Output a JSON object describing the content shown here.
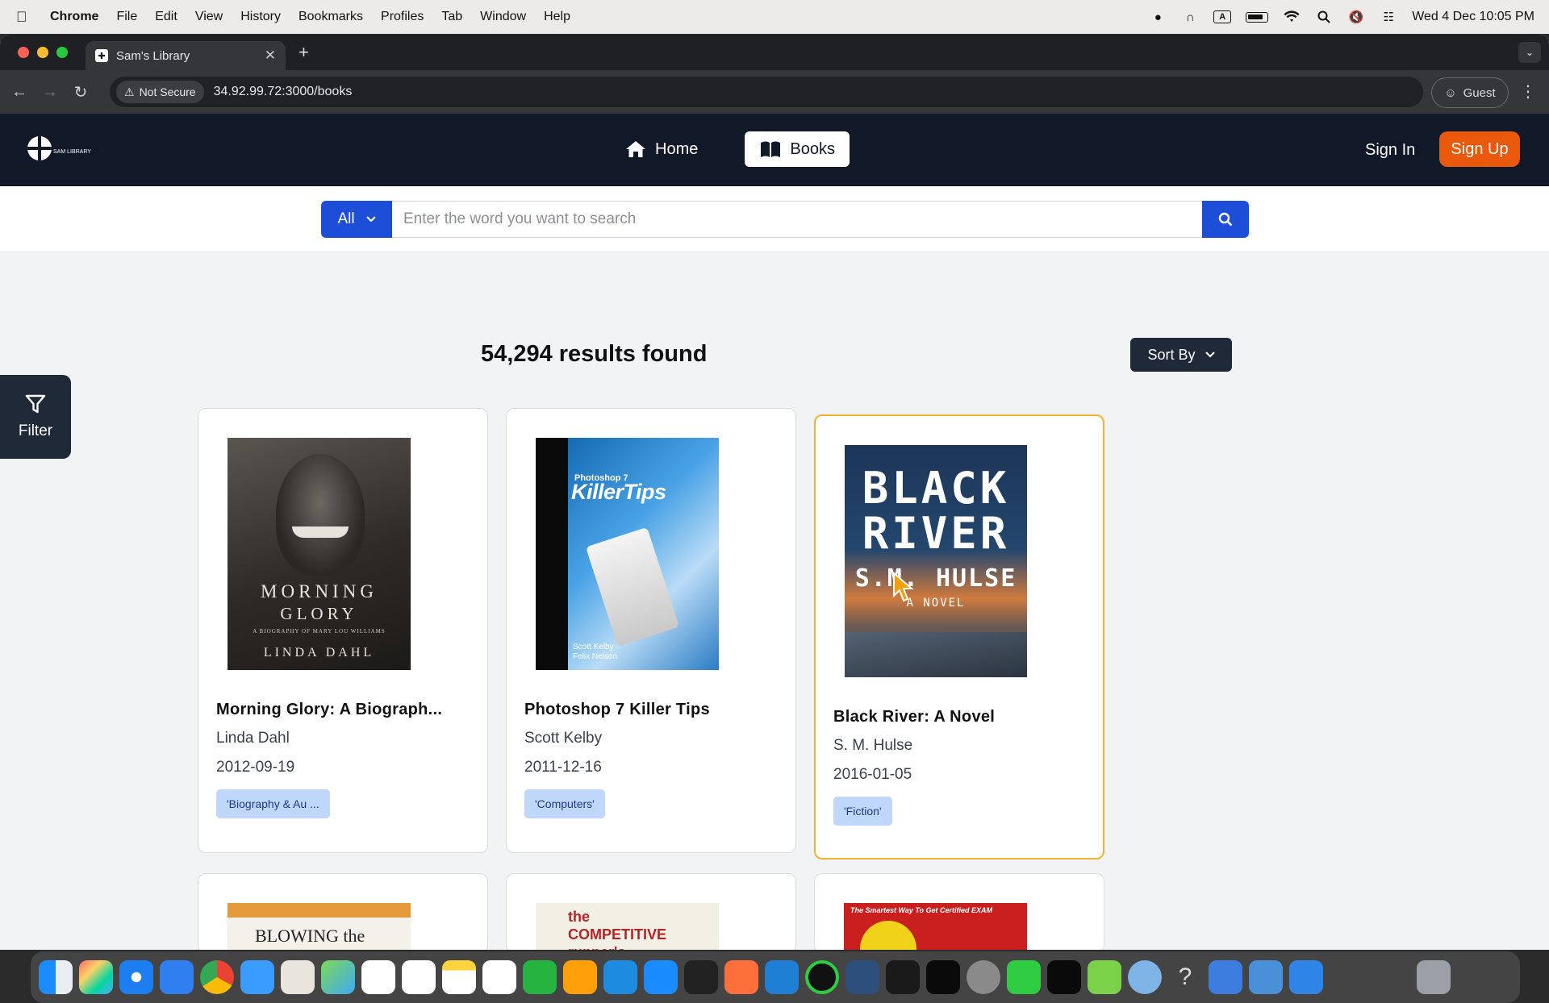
{
  "menubar": {
    "app": "Chrome",
    "items": [
      "File",
      "Edit",
      "View",
      "History",
      "Bookmarks",
      "Profiles",
      "Tab",
      "Window",
      "Help"
    ],
    "datetime": "Wed 4 Dec  10:05 PM"
  },
  "browser": {
    "tab_title": "Sam's Library",
    "security_label": "Not Secure",
    "url": "34.92.99.72:3000/books",
    "profile": "Guest"
  },
  "site": {
    "logo_text": "SAM LIBRARY",
    "nav": {
      "home": "Home",
      "books": "Books"
    },
    "sign_in": "Sign In",
    "sign_up": "Sign Up"
  },
  "search": {
    "category": "All",
    "placeholder": "Enter the word you want to search"
  },
  "results": {
    "count_text": "54,294 results found",
    "sort_label": "Sort By",
    "filter_label": "Filter"
  },
  "books": [
    {
      "title": "Morning Glory: A Biograph...",
      "author": "Linda Dahl",
      "date": "2012-09-19",
      "tag": "'Biography & Au ...",
      "cover": {
        "lines": [
          "MORNING",
          "GLORY",
          "A BIOGRAPHY OF MARY LOU WILLIAMS",
          "LINDA DAHL"
        ]
      }
    },
    {
      "title": "Photoshop 7 Killer Tips",
      "author": "Scott Kelby",
      "date": "2011-12-16",
      "tag": "'Computers'",
      "cover": {
        "lines": [
          "Photoshop 7",
          "KillerTips",
          "Scott Kelby",
          "Felix Nelson"
        ]
      }
    },
    {
      "title": "Black River: A Novel",
      "author": "S. M. Hulse",
      "date": "2016-01-05",
      "tag": "'Fiction'",
      "cover": {
        "lines": [
          "BLACK",
          "RIVER",
          "S.M. HULSE",
          "A NOVEL"
        ]
      }
    }
  ],
  "next_row_covers": [
    "BLOWING the",
    "the COMPETITIVE runner's",
    "The Smartest Way To Get Certified EXAM"
  ]
}
